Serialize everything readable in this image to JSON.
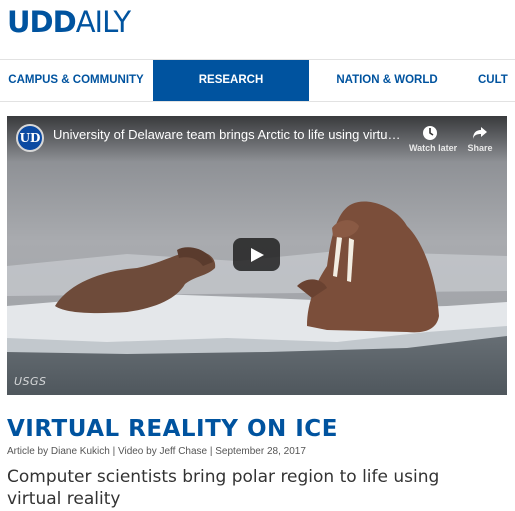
{
  "header": {
    "logo_ud": "UD",
    "logo_daily": "AILY"
  },
  "nav": {
    "items": [
      {
        "label": "CAMPUS & COMMUNITY",
        "active": false
      },
      {
        "label": "RESEARCH",
        "active": true
      },
      {
        "label": "NATION & WORLD",
        "active": false
      },
      {
        "label": "CULT",
        "active": false
      }
    ]
  },
  "video": {
    "channel_logo": "UD",
    "title": "University of Delaware team brings Arctic to life using virtual real...",
    "watch_later_label": "Watch later",
    "share_label": "Share",
    "play_icon": "play-icon",
    "watermark": "USGS"
  },
  "article": {
    "headline": "VIRTUAL REALITY ON ICE",
    "byline": "Article by Diane Kukich | Video by Jeff Chase | September 28, 2017",
    "subhead": "Computer scientists bring polar region to life using virtual reality"
  },
  "colors": {
    "brand_blue": "#00539f",
    "nav_active_bg": "#00539f",
    "text": "#333333"
  }
}
